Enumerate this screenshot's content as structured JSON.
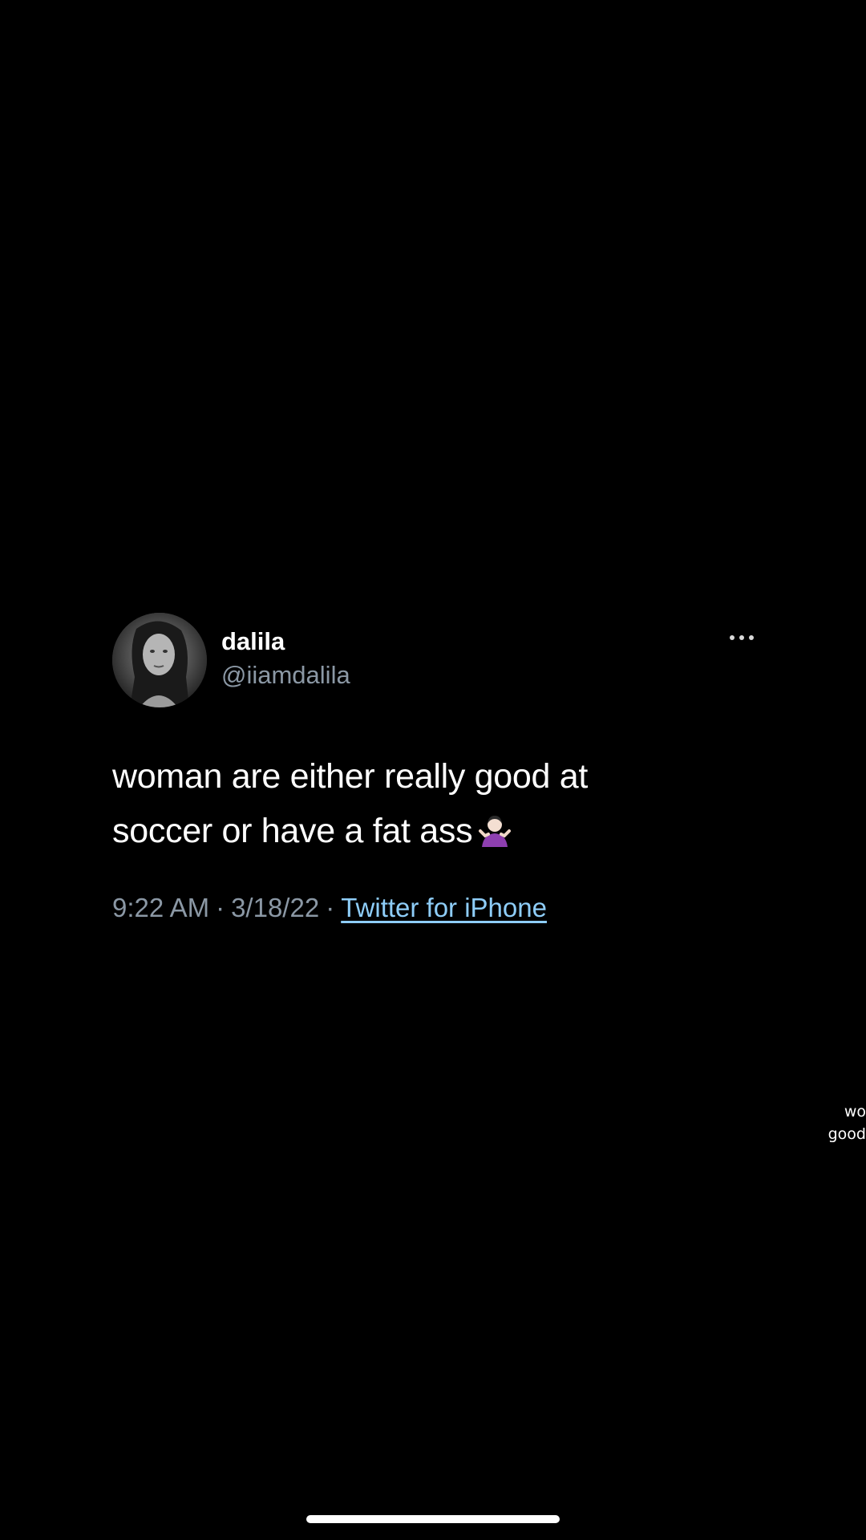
{
  "tweet": {
    "display_name": "dalila",
    "handle": "@iiamdalila",
    "text": "woman are either really good at soccer or have a fat ass",
    "emoji_icon": "person-shrugging-icon",
    "time": "9:22 AM",
    "date": "3/18/22",
    "separator": "·",
    "source": "Twitter for iPhone",
    "more_icon": "more-horizontal-icon",
    "colors": {
      "background": "#000000",
      "secondary_text": "#8b98a5",
      "link": "#8ecdf8"
    }
  },
  "side_caption": {
    "line1": "wo",
    "line2": "good"
  }
}
